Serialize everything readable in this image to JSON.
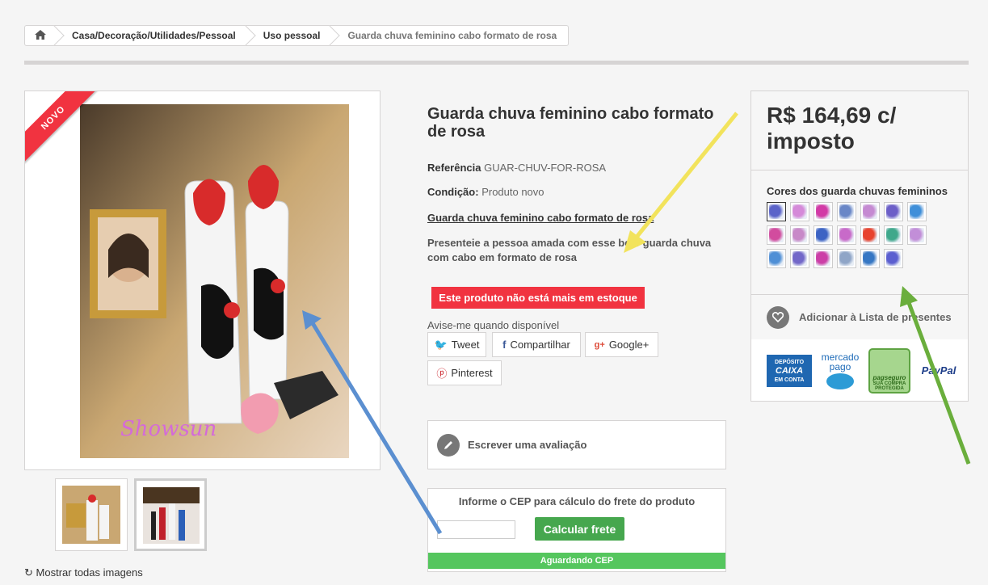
{
  "breadcrumb": {
    "items": [
      "Casa/Decoração/Utilidades/Pessoal",
      "Uso pessoal"
    ],
    "current": "Guarda chuva feminino cabo formato de rosa"
  },
  "image": {
    "badge": "NOVO",
    "show_all": "Mostrar todas imagens",
    "watermark": "Showsun"
  },
  "product": {
    "title": "Guarda chuva feminino cabo formato de rosa",
    "reference_label": "Referência",
    "reference_value": "GUAR-CHUV-FOR-ROSA",
    "condition_label": "Condição:",
    "condition_value": "Produto novo",
    "link_text": "Guarda chuva feminino cabo formato de rosa",
    "description": "Presenteie a pessoa amada com esse belo guarda chuva com cabo em formato de rosa",
    "stock_status": "Este produto não está mais em estoque",
    "notify_text": "Avise-me quando disponível"
  },
  "share": {
    "tweet": "Tweet",
    "facebook": "Compartilhar",
    "google": "Google+",
    "pinterest": "Pinterest"
  },
  "review": {
    "label": "Escrever uma avaliação"
  },
  "shipping": {
    "title": "Informe o CEP para cálculo do frete do produto",
    "input_value": "",
    "button": "Calcular frete",
    "status": "Aguardando CEP"
  },
  "price_box": {
    "price": "R$ 164,69 c/ imposto",
    "colors_title": "Cores dos guarda chuvas femininos",
    "swatch_colors": [
      "#5b63c9",
      "#d58ad9",
      "#d23aa6",
      "#6a87c7",
      "#c58ad2",
      "#6c5fc8",
      "#3f8fd9",
      "#d24c9e",
      "#c889c8",
      "#3c63c4",
      "#c86ac9",
      "#e8432e",
      "#3fa88b",
      "#c28ed8",
      "#4f8fd6",
      "#7368c9",
      "#cc3fa7",
      "#8fa5c7",
      "#3677c4",
      "#5b5fd0"
    ],
    "gift_label": "Adicionar à Lista de presentes",
    "payments": {
      "caixa_top": "DEPÓSITO",
      "caixa_name": "CAIXA",
      "caixa_bottom": "EM CONTA",
      "mercado": "mercado",
      "pago": "pago",
      "pagseguro": "pagseguro",
      "pagseguro_sub": "SUA COMPRA PROTEGIDA",
      "paypal": "PayPal"
    }
  },
  "annotation_colors": {
    "yellow_arrow": "#f2e35c",
    "blue_arrow": "#5b8fd0",
    "green_arrow": "#6aae3c"
  }
}
